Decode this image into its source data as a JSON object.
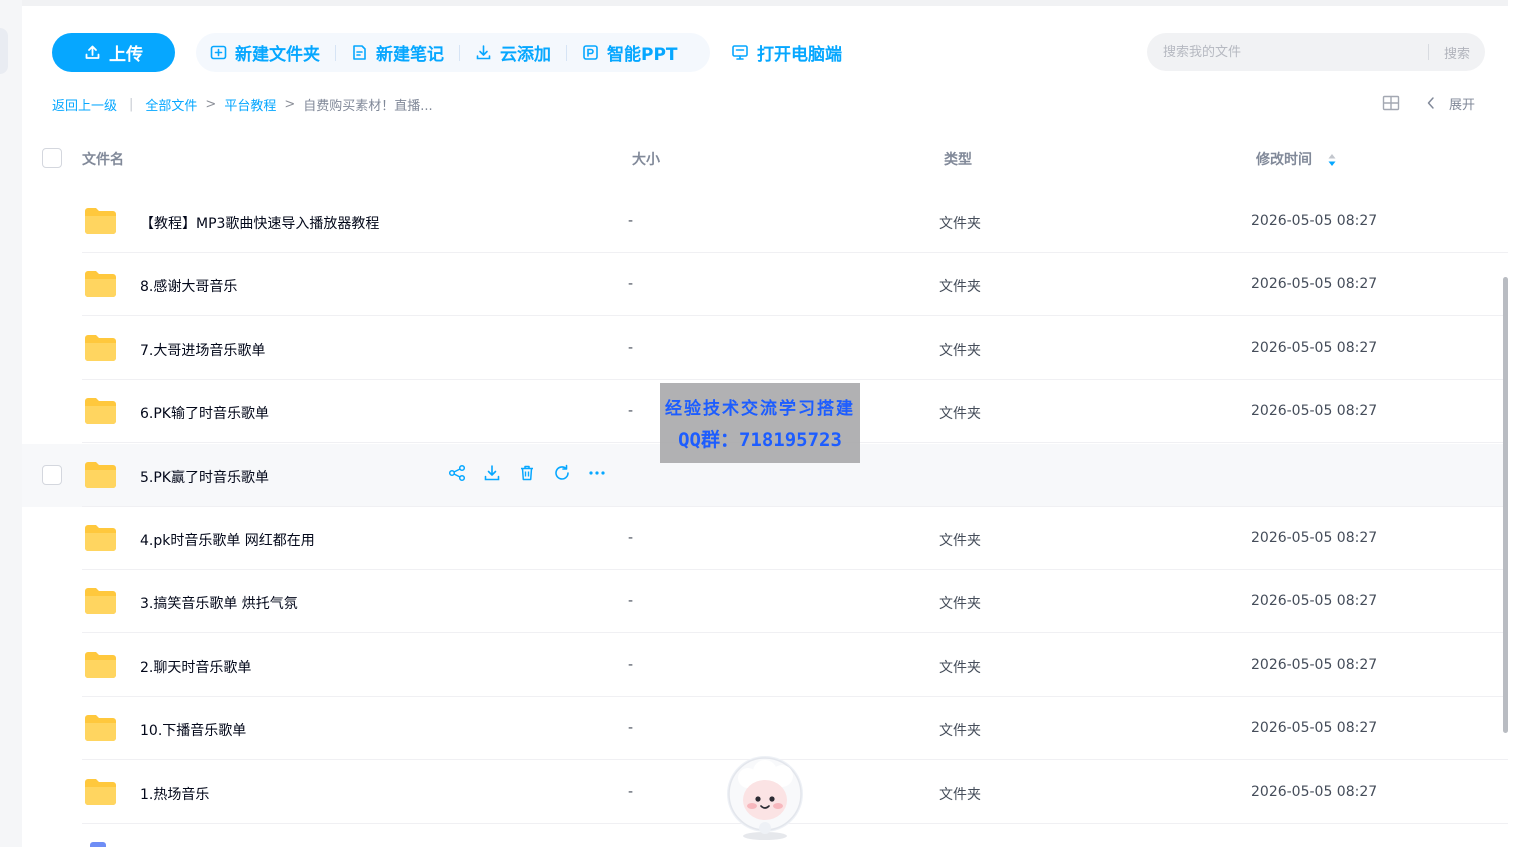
{
  "toolbar": {
    "upload_label": "上传",
    "new_folder_label": "新建文件夹",
    "new_note_label": "新建笔记",
    "cloud_add_label": "云添加",
    "smart_ppt_label": "智能PPT",
    "open_desktop_label": "打开电脑端"
  },
  "search": {
    "placeholder": "搜索我的文件",
    "button_label": "搜索"
  },
  "breadcrumb": {
    "back_label": "返回上一级",
    "separator": "|",
    "arrow": ">",
    "items": [
      "全部文件",
      "平台教程"
    ],
    "current": "自费购买素材！直播..."
  },
  "view": {
    "expand_label": "展开"
  },
  "table": {
    "columns": {
      "name": "文件名",
      "size": "大小",
      "type": "类型",
      "modified": "修改时间"
    },
    "rows": [
      {
        "name": "【教程】MP3歌曲快速导入播放器教程",
        "size": "-",
        "type": "文件夹",
        "modified": "2026-05-05 08:27"
      },
      {
        "name": "8.感谢大哥音乐",
        "size": "-",
        "type": "文件夹",
        "modified": "2026-05-05 08:27"
      },
      {
        "name": "7.大哥进场音乐歌单",
        "size": "-",
        "type": "文件夹",
        "modified": "2026-05-05 08:27"
      },
      {
        "name": "6.PK输了时音乐歌单",
        "size": "-",
        "type": "文件夹",
        "modified": "2026-05-05 08:27"
      },
      {
        "name": "5.PK赢了时音乐歌单",
        "size": "",
        "type": "",
        "modified": ""
      },
      {
        "name": "4.pk时音乐歌单 网红都在用",
        "size": "-",
        "type": "文件夹",
        "modified": "2026-05-05 08:27"
      },
      {
        "name": "3.搞笑音乐歌单 烘托气氛",
        "size": "-",
        "type": "文件夹",
        "modified": "2026-05-05 08:27"
      },
      {
        "name": "2.聊天时音乐歌单",
        "size": "-",
        "type": "文件夹",
        "modified": "2026-05-05 08:27"
      },
      {
        "name": "10.下播音乐歌单",
        "size": "-",
        "type": "文件夹",
        "modified": "2026-05-05 08:27"
      },
      {
        "name": "1.热场音乐",
        "size": "-",
        "type": "文件夹",
        "modified": "2026-05-05 08:27"
      }
    ],
    "hovered_row": 4
  },
  "watermark": {
    "line1": "经验技术交流学习搭建",
    "line2": "QQ群：718195723"
  },
  "colors": {
    "accent": "#06a7ff",
    "folder": "#ffc83d",
    "hover_row": "#f7f8fa"
  }
}
